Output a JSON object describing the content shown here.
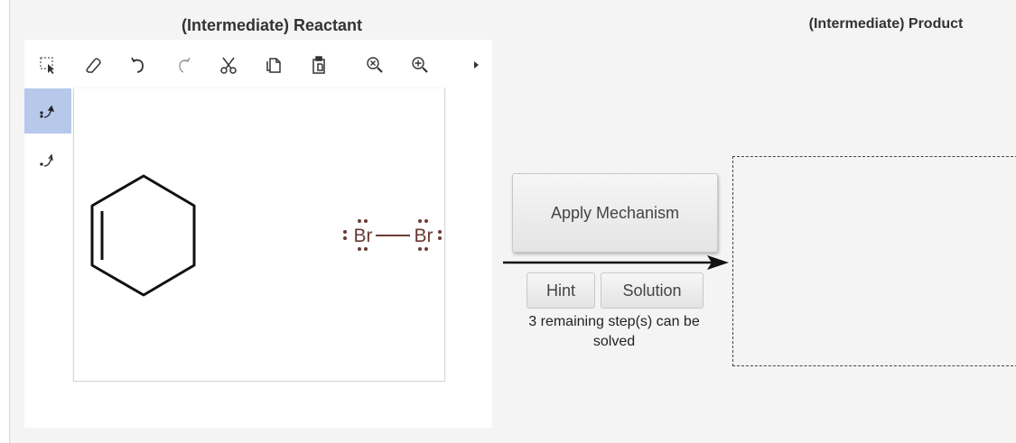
{
  "reactant": {
    "title": "(Intermediate) Reactant"
  },
  "product": {
    "title": "(Intermediate) Product"
  },
  "toolbar": {
    "tools": [
      {
        "name": "select-tool",
        "icon": "dashed-select-icon"
      },
      {
        "name": "eraser-tool",
        "icon": "eraser-icon"
      },
      {
        "name": "undo-tool",
        "icon": "undo-icon"
      },
      {
        "name": "redo-tool",
        "icon": "redo-icon"
      },
      {
        "name": "cut-tool",
        "icon": "scissors-icon"
      },
      {
        "name": "copy-tool",
        "icon": "copy-icon"
      },
      {
        "name": "paste-tool",
        "icon": "paste-icon"
      },
      {
        "name": "zoom-reset-tool",
        "icon": "zoom-reset-icon"
      },
      {
        "name": "zoom-in-tool",
        "icon": "zoom-in-icon"
      },
      {
        "name": "more-tools",
        "icon": "triangle-right-icon"
      }
    ]
  },
  "side_tools": [
    {
      "name": "electron-pair-arrow",
      "icon": "curved-arrow-pair-icon",
      "active": true
    },
    {
      "name": "single-electron-arrow",
      "icon": "curved-arrow-single-icon",
      "active": false
    }
  ],
  "molecules": {
    "bromine_left_atom": "Br",
    "bromine_right_atom": "Br"
  },
  "mechanism": {
    "apply_label": "Apply Mechanism",
    "hint_label": "Hint",
    "solution_label": "Solution",
    "remaining_text": "3 remaining step(s) can be solved"
  },
  "colors": {
    "bromine": "#6b3a34",
    "active_tool": "#b7c9ea",
    "panel_bg": "#f4f4f4"
  }
}
